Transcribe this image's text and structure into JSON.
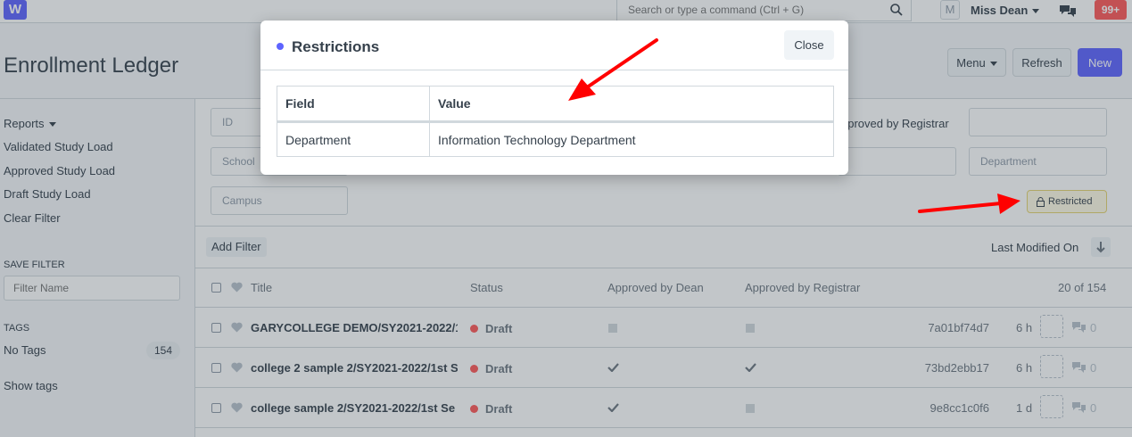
{
  "navbar": {
    "logo": "W",
    "search_placeholder": "Search or type a command (Ctrl + G)",
    "avatar_initial": "M",
    "user_name": "Miss Dean",
    "notification_count": "99+"
  },
  "page": {
    "title": "Enrollment Ledger",
    "menu_label": "Menu",
    "refresh_label": "Refresh",
    "new_label": "New"
  },
  "sidebar": {
    "reports_label": "Reports",
    "items": [
      "Validated Study Load",
      "Approved Study Load",
      "Draft Study Load",
      "Clear Filter"
    ],
    "save_filter_heading": "SAVE FILTER",
    "filter_name_placeholder": "Filter Name",
    "tags_heading": "TAGS",
    "no_tags_label": "No Tags",
    "no_tags_count": "154",
    "show_tags_label": "Show tags"
  },
  "filters": {
    "id_placeholder": "ID",
    "school_placeholder": "School",
    "campus_placeholder": "Campus",
    "approved_registrar_label": "pproved by Registrar",
    "department_placeholder": "Department",
    "restricted_label": "Restricted",
    "add_filter_label": "Add Filter",
    "sort_label": "Last Modified On"
  },
  "list": {
    "columns": {
      "title": "Title",
      "status": "Status",
      "approved_dean": "Approved by Dean",
      "approved_registrar": "Approved by Registrar",
      "count": "20 of 154"
    },
    "rows": [
      {
        "title": "GARYCOLLEGE DEMO/SY2021-2022/1",
        "status": "Draft",
        "dean": false,
        "registrar": false,
        "id": "7a01bf74d7",
        "time": "6 h",
        "comments": "0"
      },
      {
        "title": "college 2 sample 2/SY2021-2022/1st S",
        "status": "Draft",
        "dean": true,
        "registrar": true,
        "id": "73bd2ebb17",
        "time": "6 h",
        "comments": "0"
      },
      {
        "title": "college sample 2/SY2021-2022/1st Se",
        "status": "Draft",
        "dean": true,
        "registrar": false,
        "id": "9e8cc1c0f6",
        "time": "1 d",
        "comments": "0"
      }
    ]
  },
  "modal": {
    "title": "Restrictions",
    "close_label": "Close",
    "table": {
      "headers": [
        "Field",
        "Value"
      ],
      "rows": [
        [
          "Department",
          "Information Technology Department"
        ]
      ]
    }
  },
  "colors": {
    "primary": "#5e64ff",
    "danger": "#ff5858",
    "arrow": "#ff0000",
    "restricted_bg": "#fffbe6"
  }
}
